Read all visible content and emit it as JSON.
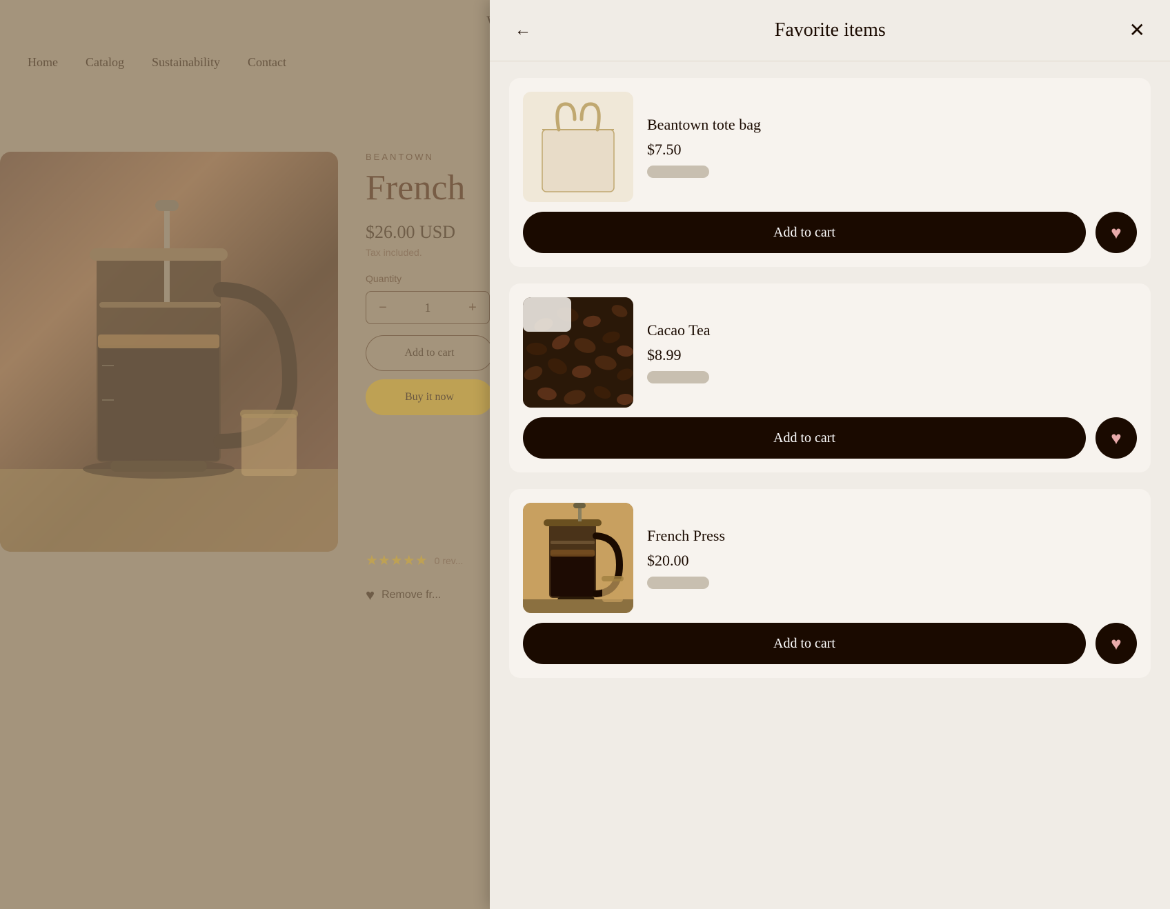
{
  "site": {
    "welcome": "Welcome to Beantown Coffee!",
    "nav": {
      "items": [
        "Home",
        "Catalog",
        "Sustainability",
        "Contact"
      ]
    }
  },
  "product": {
    "brand": "BEANTOWN",
    "title": "French",
    "price": "$26.00 USD",
    "tax_note": "Tax included.",
    "quantity_label": "Quantity",
    "quantity_value": "1",
    "reviews_count": "0 rev...",
    "remove_label": "Remove fr..."
  },
  "panel": {
    "title": "Favorite items",
    "back_label": "←",
    "close_label": "✕",
    "items": [
      {
        "name": "Beantown tote bag",
        "price": "$7.50",
        "add_to_cart_label": "Add to cart",
        "image_type": "tote"
      },
      {
        "name": "Cacao Tea",
        "price": "$8.99",
        "add_to_cart_label": "Add to cart",
        "image_type": "cacao"
      },
      {
        "name": "French Press",
        "price": "$20.00",
        "add_to_cart_label": "Add to cart",
        "image_type": "french_press"
      }
    ]
  },
  "colors": {
    "black": "#1a0a00",
    "gold": "#c9a227",
    "cream": "#f0ece6",
    "heart": "#e8b4b4"
  }
}
